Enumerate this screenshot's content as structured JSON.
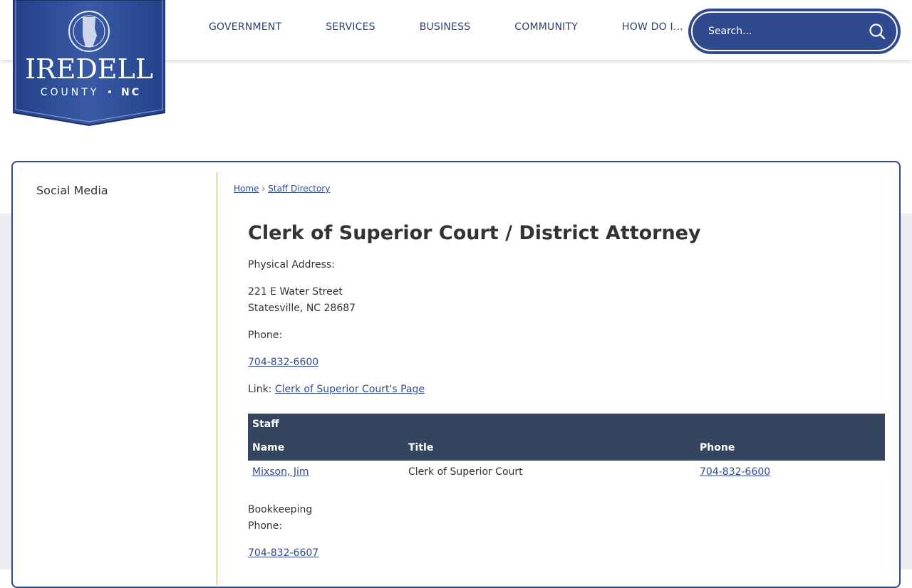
{
  "logo": {
    "name": "IREDELL",
    "sub": "COUNTY",
    "state": "NC"
  },
  "nav": [
    "GOVERNMENT",
    "SERVICES",
    "BUSINESS",
    "COMMUNITY",
    "HOW DO I..."
  ],
  "search": {
    "placeholder": "Search..."
  },
  "sidebar": {
    "item": "Social Media"
  },
  "breadcrumb": {
    "home": "Home",
    "separator": "›",
    "current": "Staff Directory"
  },
  "department": {
    "title": "Clerk of Superior Court / District Attorney",
    "address_label": "Physical Address:",
    "address_line1": "221 E Water Street",
    "address_line2": "Statesville, NC 28687",
    "phone_label": "Phone:",
    "phone": "704-832-6600",
    "link_label": "Link:",
    "link_text": "Clerk of Superior Court's Page"
  },
  "staff": {
    "caption": "Staff",
    "headers": {
      "name": "Name",
      "title": "Title",
      "phone": "Phone"
    },
    "rows": [
      {
        "name": "Mixson, Jim",
        "title": "Clerk of Superior Court",
        "phone": "704-832-6600"
      }
    ]
  },
  "bookkeeping": {
    "label": "Bookkeeping",
    "phone_label": "Phone:",
    "phone": "704-832-6607"
  },
  "colors": {
    "brand": "#2f4a8f",
    "table_header": "#35445f",
    "divider": "#c7a26a"
  }
}
